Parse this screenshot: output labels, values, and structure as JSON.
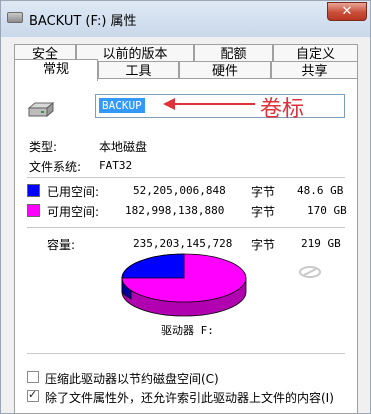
{
  "window": {
    "title": "BACKUT (F:) 属性",
    "close": "✕"
  },
  "tabs_row1": [
    {
      "label": "安全"
    },
    {
      "label": "以前的版本"
    },
    {
      "label": "配额"
    },
    {
      "label": "自定义"
    }
  ],
  "tabs_row2": [
    {
      "label": "常规"
    },
    {
      "label": "工具"
    },
    {
      "label": "硬件"
    },
    {
      "label": "共享"
    }
  ],
  "general": {
    "volume_label_value": "BACKUP",
    "annotation": "卷标",
    "type_label": "类型:",
    "type_value": "本地磁盘",
    "fs_label": "文件系统:",
    "fs_value": "FAT32",
    "used": {
      "label": "已用空间:",
      "bytes": "52,205,006,848",
      "unit": "字节",
      "size": "48.6 GB",
      "color": "#0000ff"
    },
    "free": {
      "label": "可用空间:",
      "bytes": "182,998,138,880",
      "unit": "字节",
      "size": "170 GB",
      "color": "#ff00ff"
    },
    "capacity": {
      "label": "容量:",
      "bytes": "235,203,145,728",
      "unit": "字节",
      "size": "219 GB"
    },
    "drive_label": "驱动器 F:",
    "compress_label": "压缩此驱动器以节约磁盘空间(C)",
    "compress_checked": false,
    "index_label": "除了文件属性外，还允许索引此驱动器上文件的内容(I)",
    "index_checked": true
  }
}
